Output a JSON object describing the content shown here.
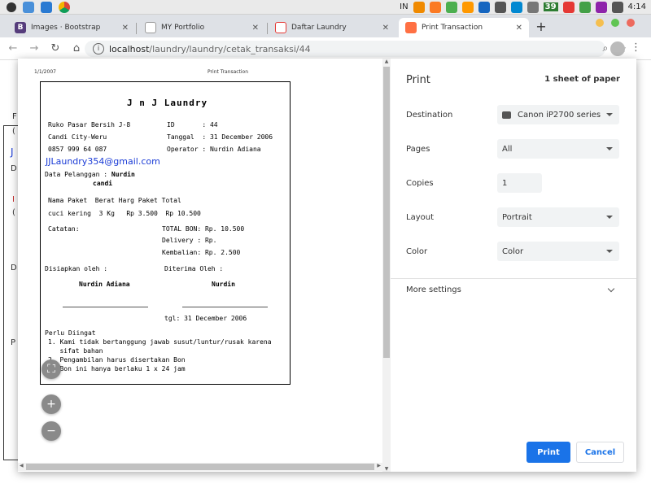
{
  "sysbar": {
    "input_lang": "IN",
    "badge": "39",
    "time": "4:14"
  },
  "tabs": [
    {
      "title": "Images · Bootstrap",
      "favicon": "B",
      "color": "#563d7c"
    },
    {
      "title": "MY Portfolio",
      "favicon": "",
      "color": "#999999"
    },
    {
      "title": "Daftar Laundry",
      "favicon": "",
      "color": "#e53935"
    },
    {
      "title": "Print Transaction",
      "favicon": "",
      "color": "#ff7043"
    }
  ],
  "address": {
    "host": "localhost",
    "path": "/laundry/laundry/cetak_transaksi/44"
  },
  "preview": {
    "header_date": "1/1/2007",
    "header_title": "Print Transaction",
    "receipt": {
      "title": "J n J Laundry",
      "address1": "Ruko Pasar Bersih J-8",
      "address2": "Candi City-Weru",
      "phone": "0857 999 64 087",
      "id_line": "ID       : 44",
      "date_line": "Tanggal  : 31 December 2006",
      "operator_line": "Operator : Nurdin Adiana",
      "email": "JJLaundry354@gmail.com",
      "customer_label": "Data Pelanggan : ",
      "customer_name": "Nurdin",
      "customer_name2": "candi",
      "items_header": "Nama Paket  Berat Harg Paket Total",
      "item_row": "cuci kering  3 Kg   Rp 3.500  Rp 10.500",
      "notes_label": "Catatan:",
      "total_line": "TOTAL BON: Rp. 10.500",
      "delivery_line": "Delivery : Rp.",
      "change_line": "Kembalian: Rp. 2.500",
      "prepared_label": "Disiapkan oleh :",
      "received_label": "Diterima Oleh :",
      "prepared_name": "Nurdin Adiana",
      "received_name": "Nurdin",
      "tgl_line": "tgl: 31 December 2006",
      "reminder_title": "Perlu Diingat",
      "reminder1": "1. Kami tidak bertanggung jawab susut/luntur/rusak karena",
      "reminder1b": "   sifat bahan",
      "reminder2": "2. Pengambilan harus disertakan Bon",
      "reminder3": "3. Bon ini hanya berlaku 1 x 24 jam"
    }
  },
  "settings": {
    "title": "Print",
    "sheets": "1 sheet of paper",
    "destination_label": "Destination",
    "destination_value": "Canon iP2700 series",
    "pages_label": "Pages",
    "pages_value": "All",
    "copies_label": "Copies",
    "copies_value": "1",
    "layout_label": "Layout",
    "layout_value": "Portrait",
    "color_label": "Color",
    "color_value": "Color",
    "more_settings": "More settings",
    "print_button": "Print",
    "cancel_button": "Cancel"
  },
  "background": {
    "chars": [
      "F",
      "(",
      "J",
      "D",
      "I",
      "(",
      "D",
      "P"
    ]
  },
  "colors": {
    "accent": "#1a73e8",
    "email": "#1a3bd6"
  }
}
